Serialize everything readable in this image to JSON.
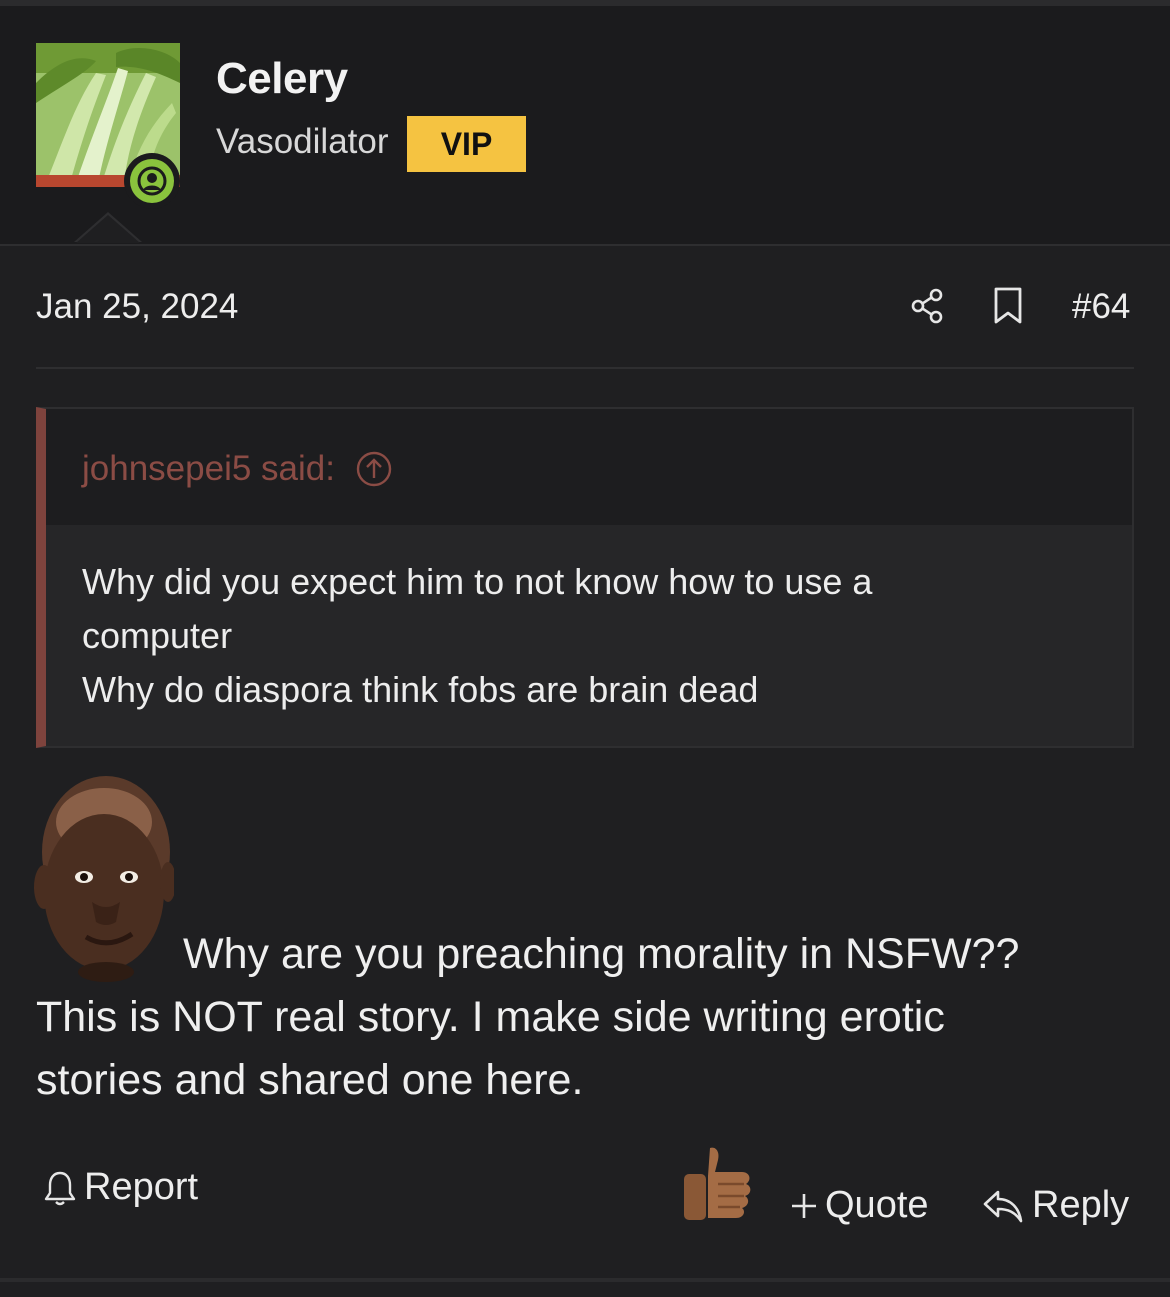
{
  "post": {
    "author": {
      "username": "Celery",
      "user_title": "Vasodilator",
      "badge": "VIP",
      "avatar_icon": "celery-avatar",
      "status_icon": "online-user-icon"
    },
    "date": "Jan 25, 2024",
    "number": "#64",
    "quote": {
      "author_label": "johnsepei5 said:",
      "lines": [
        "Why did you expect him to not know how to use a",
        "computer",
        "Why do diaspora think fobs are brain dead"
      ]
    },
    "body": {
      "lines": [
        "Why are you preaching morality in NSFW??",
        "This is NOT real story. I make side writing erotic",
        "stories and shared one here."
      ],
      "emoji_icon": "face-emoji"
    },
    "actions": {
      "report": "Report",
      "quote": "Quote",
      "reply": "Reply",
      "reaction_icon": "thumbs-up-icon"
    }
  },
  "colors": {
    "background": "#1f1f21",
    "header_bg": "#1b1b1d",
    "vip": "#f5c341",
    "quote_accent": "#7e433d",
    "quote_author": "#8b4c45",
    "online": "#8ac33d"
  }
}
